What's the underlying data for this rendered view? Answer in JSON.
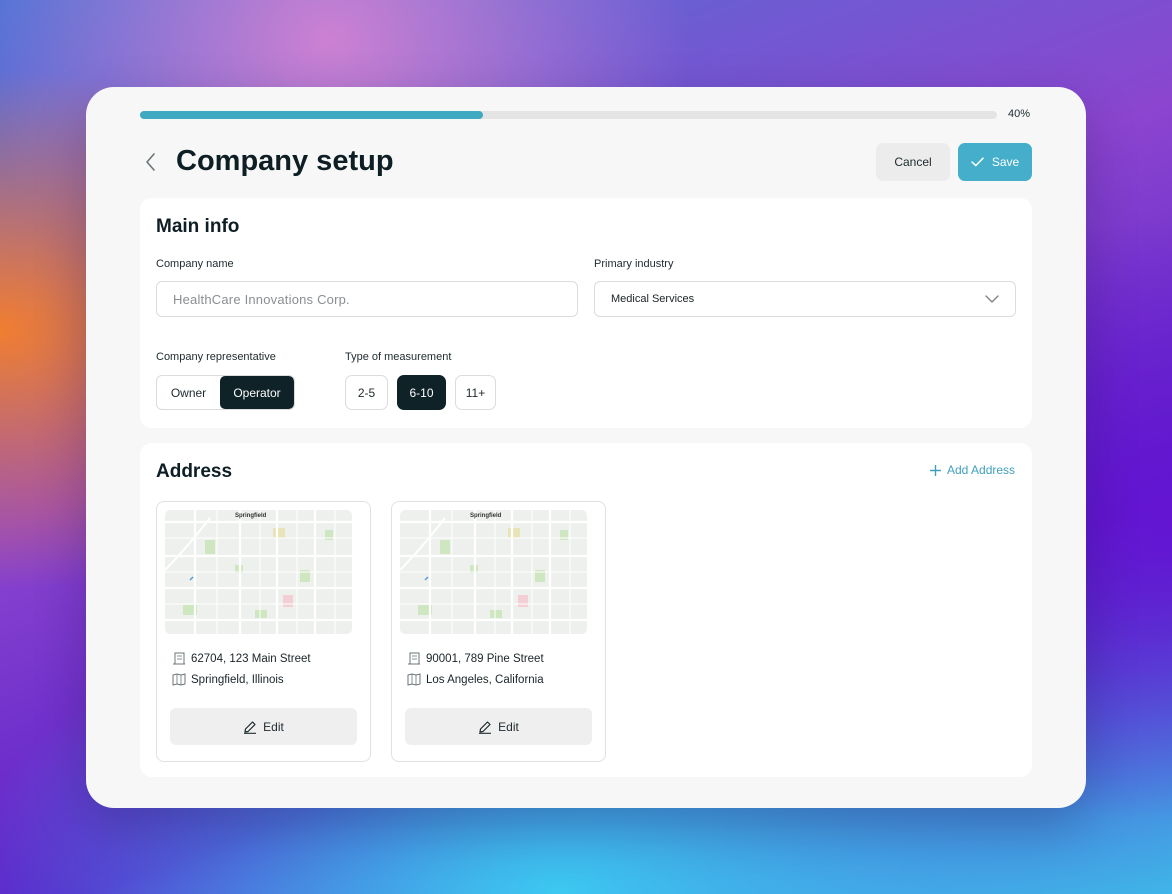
{
  "progress": {
    "percent": 40,
    "label": "40%"
  },
  "header": {
    "title": "Company setup",
    "cancel_label": "Cancel",
    "save_label": "Save"
  },
  "main_info": {
    "title": "Main info",
    "company_name_label": "Company name",
    "company_name_value": "HealthCare Innovations Corp.",
    "industry_label": "Primary industry",
    "industry_value": "Medical Services",
    "representative_label": "Company representative",
    "representative_options": [
      "Owner",
      "Operator"
    ],
    "representative_selected": "Operator",
    "measurement_label": "Type of measurement",
    "measurement_options": [
      "2-5",
      "6-10",
      "11+"
    ],
    "measurement_selected": "6-10"
  },
  "address": {
    "title": "Address",
    "add_label": "Add Address",
    "cards": [
      {
        "line1": "62704, 123 Main Street",
        "line2": "Springfield, Illinois",
        "map_city": "Springfield",
        "edit_label": "Edit"
      },
      {
        "line1": "90001, 789 Pine Street",
        "line2": "Los Angeles, California",
        "map_city": "Springfield",
        "edit_label": "Edit"
      }
    ]
  },
  "colors": {
    "accent": "#44aecb",
    "dark": "#0e2227",
    "progress": "#3fa9c1"
  }
}
